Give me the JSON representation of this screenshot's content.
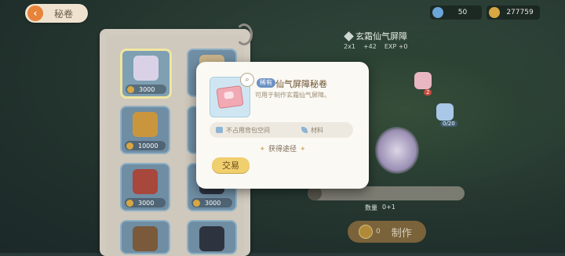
{
  "header": {
    "back_label": "秘卷"
  },
  "resources": [
    {
      "icon": "energy-icon",
      "value": "50",
      "color": "#6aa6d8"
    },
    {
      "icon": "coin-icon",
      "value": "277759",
      "color": "#d8a743"
    }
  ],
  "recipe": {
    "title": "玄霜仙气屏障",
    "size": "2x1",
    "stat": "+42",
    "exp": "EXP +0"
  },
  "scroll_items": [
    {
      "price": "3000",
      "color": "#d9d2e6"
    },
    {
      "price": "10000",
      "color": "#c9963d"
    },
    {
      "price": "3000",
      "color": "#a8473c"
    }
  ],
  "scroll_items_right": [
    {
      "price": "3000"
    }
  ],
  "modal": {
    "rarity": "稀有",
    "name": "仙气屏障秘卷",
    "description": "可用于制作玄霜仙气屏障。",
    "attr_storage": "不占用背包空间",
    "attr_type": "材料",
    "obtain_label": "获得途径",
    "trade_label": "交易"
  },
  "craft": {
    "cost": "0",
    "label": "制作",
    "qty_label": "数量",
    "qty_value": "0+1"
  },
  "map_badges": {
    "a": "2",
    "b": "0/20"
  }
}
